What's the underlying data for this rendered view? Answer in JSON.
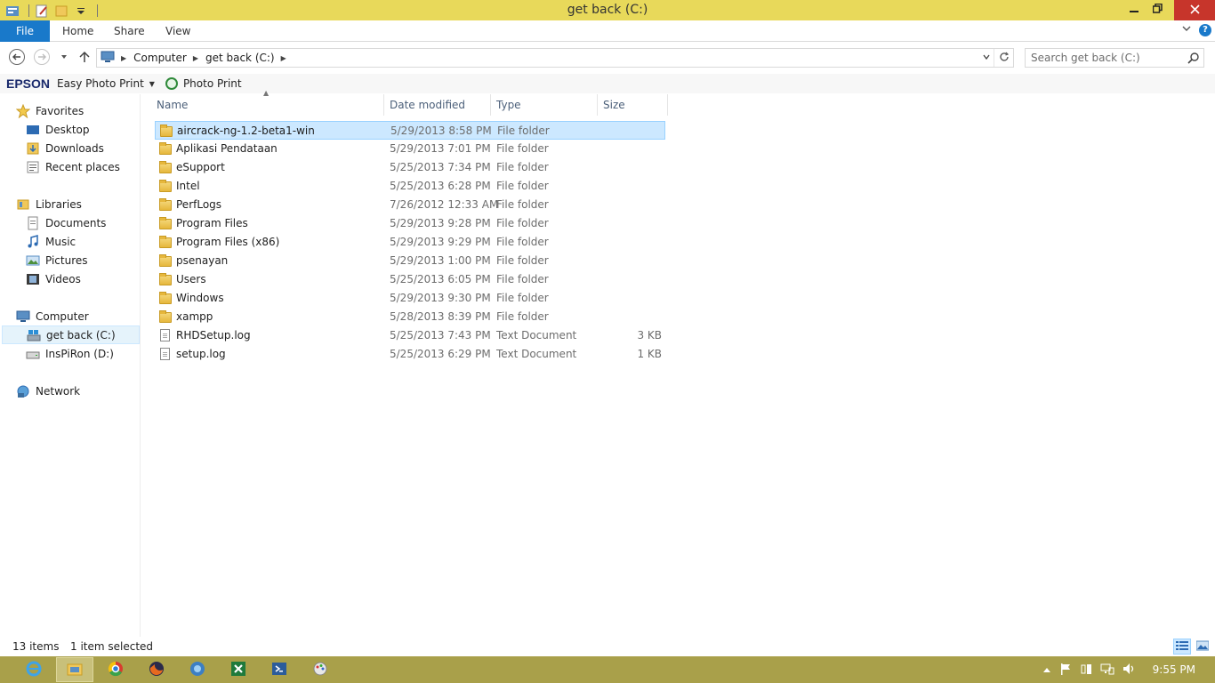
{
  "window": {
    "title": "get back (C:)",
    "accent": "#1979ca",
    "titlebar_color": "#e8d95a",
    "minimize_icon": "minimize-icon",
    "restore_icon": "restore-icon",
    "close_icon": "close-icon"
  },
  "ribbon": {
    "tabs": [
      {
        "label": "File"
      },
      {
        "label": "Home"
      },
      {
        "label": "Share"
      },
      {
        "label": "View"
      }
    ]
  },
  "address": {
    "path": [
      {
        "label": "Computer"
      },
      {
        "label": "get back (C:)"
      }
    ],
    "search_placeholder": "Search get back (C:)"
  },
  "epson": {
    "logo": "EPSON",
    "easy_photo_print": "Easy Photo Print",
    "photo_print": "Photo Print"
  },
  "sidebar": {
    "favorites": {
      "label": "Favorites",
      "items": [
        {
          "label": "Desktop"
        },
        {
          "label": "Downloads"
        },
        {
          "label": "Recent places"
        }
      ]
    },
    "libraries": {
      "label": "Libraries",
      "items": [
        {
          "label": "Documents"
        },
        {
          "label": "Music"
        },
        {
          "label": "Pictures"
        },
        {
          "label": "Videos"
        }
      ]
    },
    "computer": {
      "label": "Computer",
      "items": [
        {
          "label": "get back (C:)",
          "selected": true
        },
        {
          "label": "InsPiRon (D:)"
        }
      ]
    },
    "network": {
      "label": "Network"
    }
  },
  "columns": {
    "name": "Name",
    "date": "Date modified",
    "type": "Type",
    "size": "Size"
  },
  "files": [
    {
      "name": "aircrack-ng-1.2-beta1-win",
      "date": "5/29/2013 8:58 PM",
      "type": "File folder",
      "size": "",
      "kind": "folder",
      "selected": true
    },
    {
      "name": "Aplikasi Pendataan",
      "date": "5/29/2013 7:01 PM",
      "type": "File folder",
      "size": "",
      "kind": "folder"
    },
    {
      "name": "eSupport",
      "date": "5/25/2013 7:34 PM",
      "type": "File folder",
      "size": "",
      "kind": "folder"
    },
    {
      "name": "Intel",
      "date": "5/25/2013 6:28 PM",
      "type": "File folder",
      "size": "",
      "kind": "folder"
    },
    {
      "name": "PerfLogs",
      "date": "7/26/2012 12:33 AM",
      "type": "File folder",
      "size": "",
      "kind": "folder"
    },
    {
      "name": "Program Files",
      "date": "5/29/2013 9:28 PM",
      "type": "File folder",
      "size": "",
      "kind": "folder"
    },
    {
      "name": "Program Files (x86)",
      "date": "5/29/2013 9:29 PM",
      "type": "File folder",
      "size": "",
      "kind": "folder"
    },
    {
      "name": "psenayan",
      "date": "5/29/2013 1:00 PM",
      "type": "File folder",
      "size": "",
      "kind": "folder"
    },
    {
      "name": "Users",
      "date": "5/25/2013 6:05 PM",
      "type": "File folder",
      "size": "",
      "kind": "folder"
    },
    {
      "name": "Windows",
      "date": "5/29/2013 9:30 PM",
      "type": "File folder",
      "size": "",
      "kind": "folder"
    },
    {
      "name": "xampp",
      "date": "5/28/2013 8:39 PM",
      "type": "File folder",
      "size": "",
      "kind": "folder"
    },
    {
      "name": "RHDSetup.log",
      "date": "5/25/2013 7:43 PM",
      "type": "Text Document",
      "size": "3 KB",
      "kind": "doc"
    },
    {
      "name": "setup.log",
      "date": "5/25/2013 6:29 PM",
      "type": "Text Document",
      "size": "1 KB",
      "kind": "doc"
    }
  ],
  "status": {
    "count": "13 items",
    "selection": "1 item selected"
  },
  "taskbar": {
    "apps": [
      "ie-icon",
      "file-explorer-icon",
      "chrome-icon",
      "firefox-icon",
      "globe-icon",
      "excel-icon",
      "powershell-icon",
      "paint-icon"
    ],
    "clock": "9:55 PM"
  }
}
